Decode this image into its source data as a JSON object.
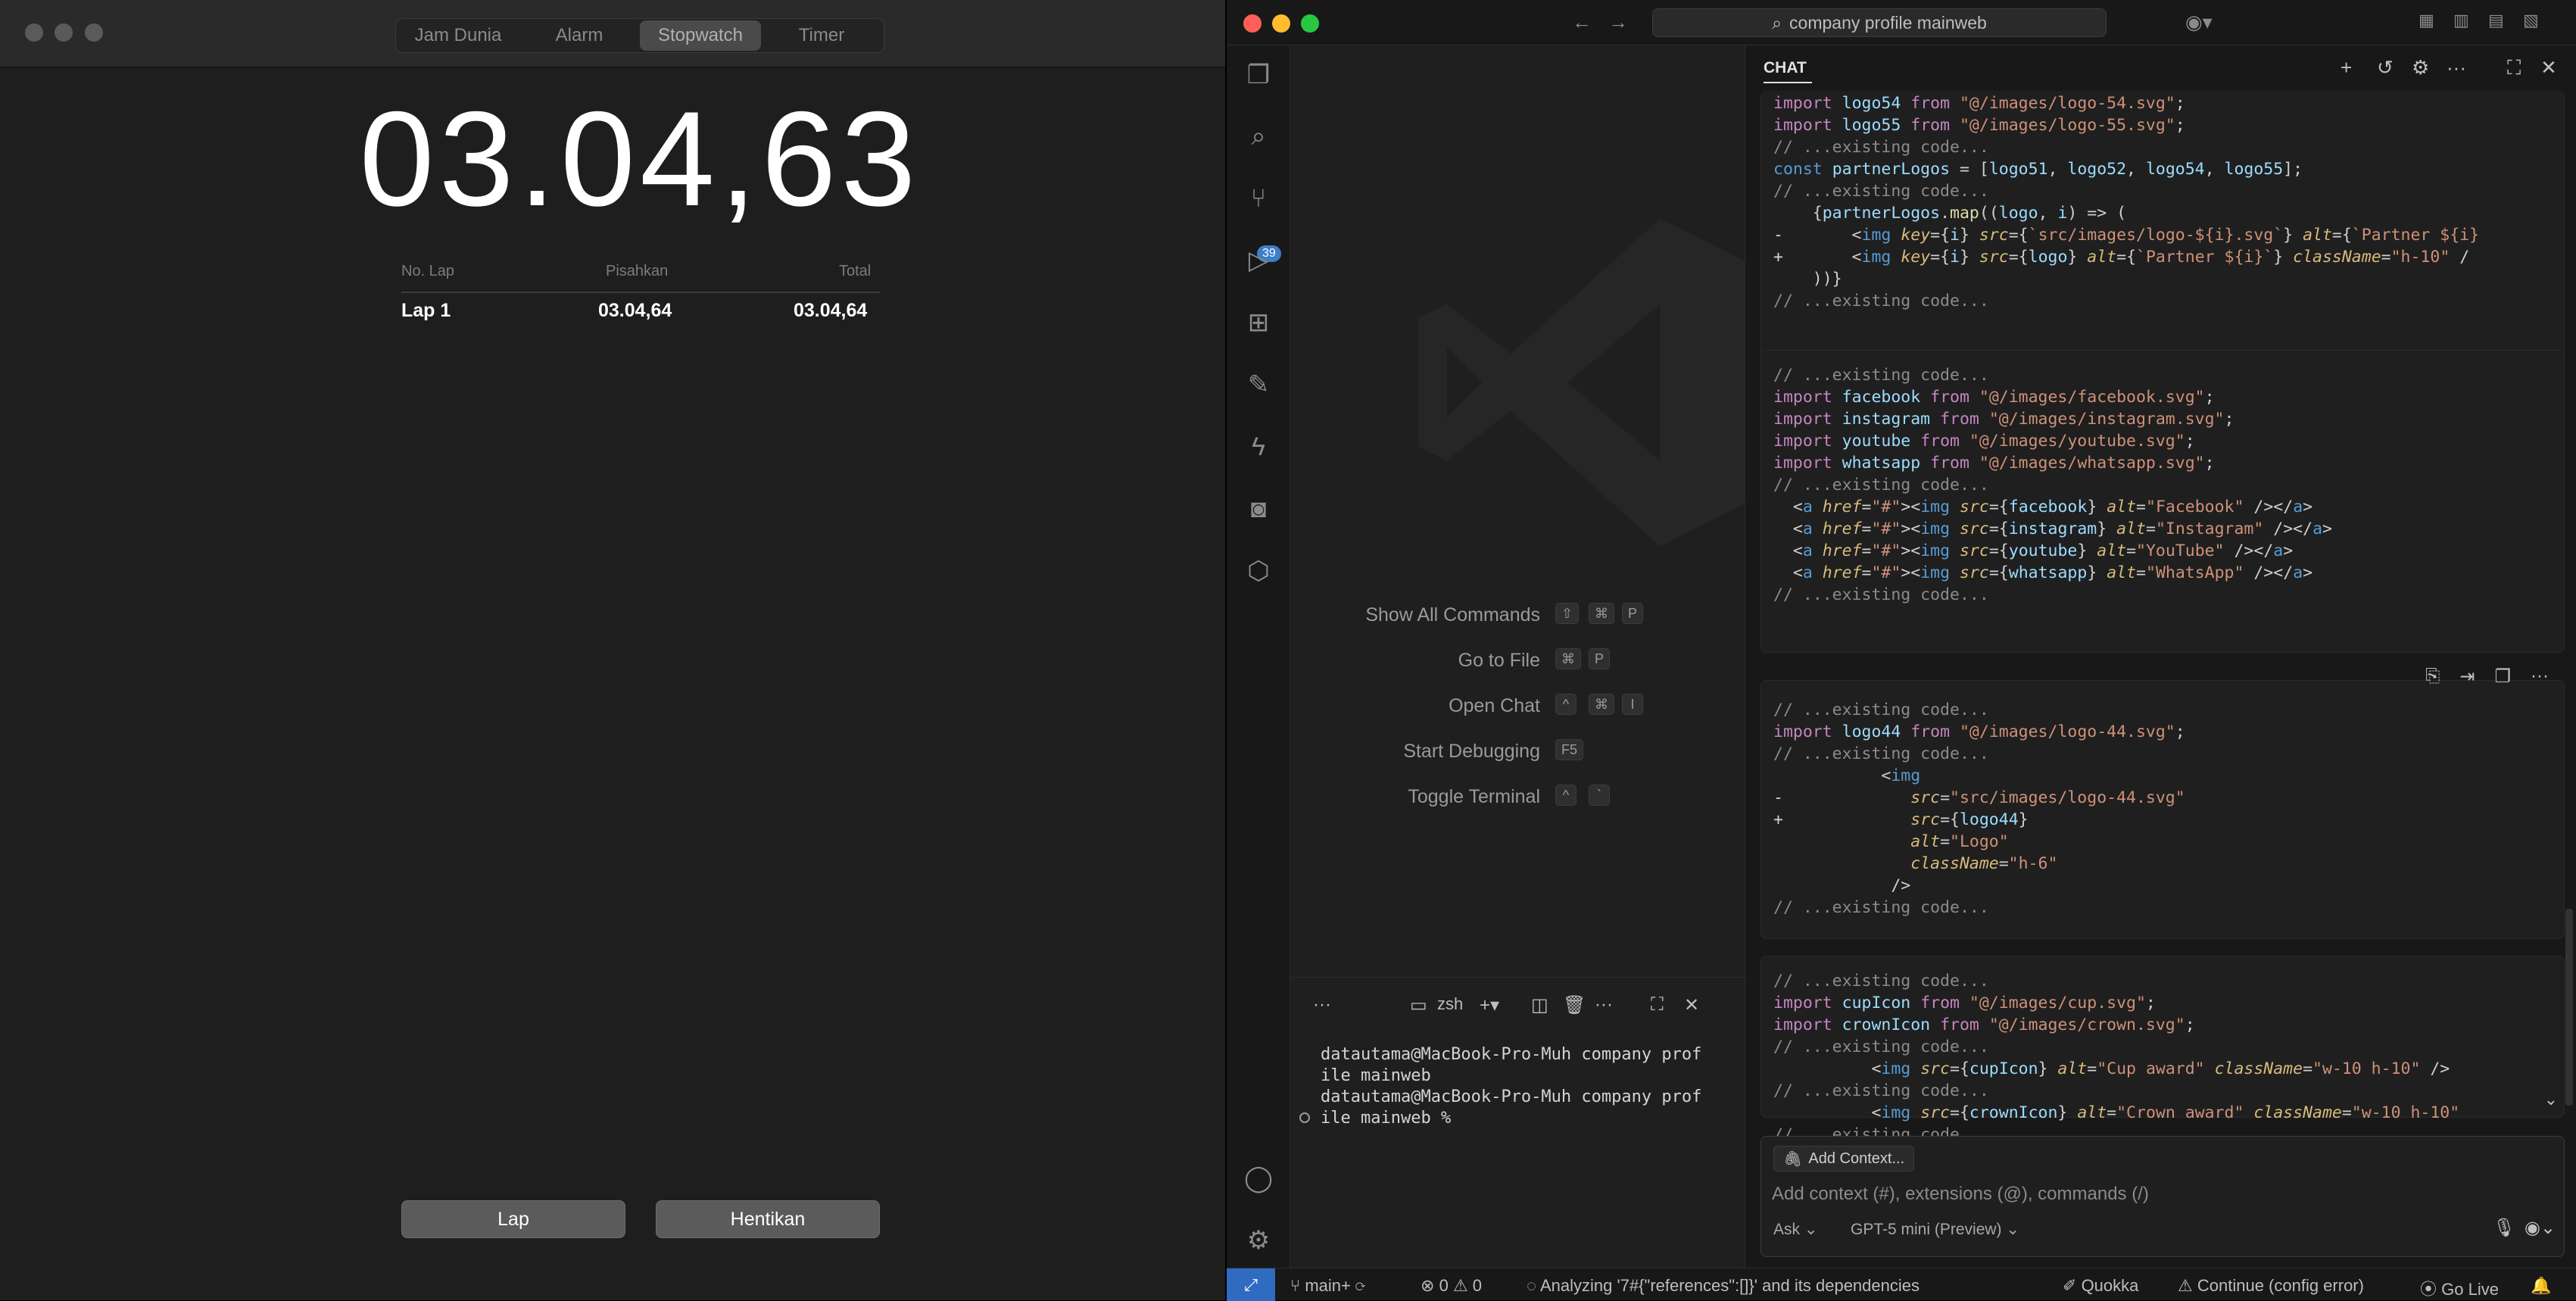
{
  "clock": {
    "tabs": [
      "Jam Dunia",
      "Alarm",
      "Stopwatch",
      "Timer"
    ],
    "active_tab": "Stopwatch",
    "time": "03.04,63",
    "columns": [
      "No. Lap",
      "Pisahkan",
      "Total"
    ],
    "laps": [
      {
        "name": "Lap 1",
        "split": "03.04,64",
        "total": "03.04,64"
      }
    ],
    "lap_button": "Lap",
    "stop_button": "Hentikan"
  },
  "vscode": {
    "search": "company profile mainweb",
    "scm_badge": "39",
    "shortcuts": [
      {
        "label": "Show All Commands",
        "keys": [
          "⇧",
          "⌘",
          "P"
        ]
      },
      {
        "label": "Go to File",
        "keys": [
          "⌘",
          "P"
        ]
      },
      {
        "label": "Open Chat",
        "keys": [
          "^",
          "⌘",
          "I"
        ]
      },
      {
        "label": "Start Debugging",
        "keys": [
          "F5"
        ]
      },
      {
        "label": "Toggle Terminal",
        "keys": [
          "^",
          "`"
        ]
      }
    ],
    "terminal": {
      "shell": "zsh",
      "lines": [
        "datautama@MacBook-Pro-Muh company prof",
        "ile mainweb",
        "datautama@MacBook-Pro-Muh company prof",
        "ile mainweb %"
      ]
    },
    "chat": {
      "title": "CHAT",
      "add_context": "Add Context...",
      "placeholder": "Add context (#), extensions (@), commands (/)",
      "mode": "Ask",
      "model": "GPT-5 mini (Preview)"
    },
    "status": {
      "branch": "main+",
      "errors": "0",
      "warnings": "0",
      "analyzing": "Analyzing '7#{\"references\":[]}' and its dependencies",
      "quokka": "Quokka",
      "continue": "Continue (config error)",
      "golive": "Go Live"
    }
  },
  "colors": {
    "accent": "#3d7ec7",
    "close": "#ff5f57",
    "minimize": "#febc2e",
    "zoom": "#28c840"
  }
}
